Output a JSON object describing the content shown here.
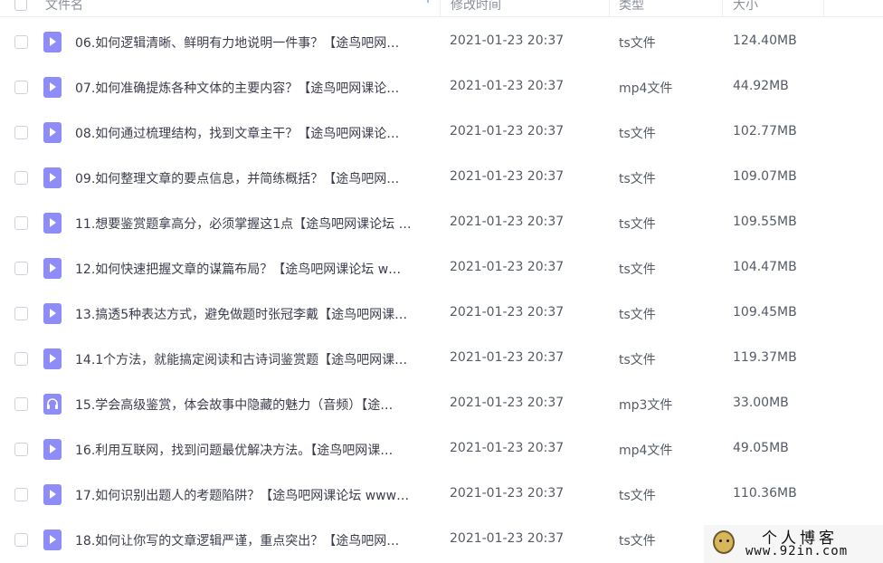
{
  "header": {
    "col_name": "文件名",
    "col_modified": "修改时间",
    "col_type": "类型",
    "col_size": "大小",
    "sort_icon": "sort-ascending-icon"
  },
  "files": [
    {
      "name": "06.如何逻辑清晰、鲜明有力地说明一件事？【途鸟吧网…",
      "date": "2021-01-23 20:37",
      "type": "ts文件",
      "size": "124.40MB",
      "icon": "video"
    },
    {
      "name": "07.如何准确提炼各种文体的主要内容？【途鸟吧网课论…",
      "date": "2021-01-23 20:37",
      "type": "mp4文件",
      "size": "44.92MB",
      "icon": "video"
    },
    {
      "name": "08.如何通过梳理结构，找到文章主干？【途鸟吧网课论…",
      "date": "2021-01-23 20:37",
      "type": "ts文件",
      "size": "102.77MB",
      "icon": "video"
    },
    {
      "name": "09.如何整理文章的要点信息，并简练概括？【途鸟吧网…",
      "date": "2021-01-23 20:37",
      "type": "ts文件",
      "size": "109.07MB",
      "icon": "video"
    },
    {
      "name": "11.想要鉴赏题拿高分，必须掌握这1点【途鸟吧网课论坛 …",
      "date": "2021-01-23 20:37",
      "type": "ts文件",
      "size": "109.55MB",
      "icon": "video"
    },
    {
      "name": "12.如何快速把握文章的谋篇布局？【途鸟吧网课论坛 w…",
      "date": "2021-01-23 20:37",
      "type": "ts文件",
      "size": "104.47MB",
      "icon": "video"
    },
    {
      "name": "13.搞透5种表达方式，避免做题时张冠李戴【途鸟吧网课…",
      "date": "2021-01-23 20:37",
      "type": "ts文件",
      "size": "109.45MB",
      "icon": "video"
    },
    {
      "name": "14.1个方法，就能搞定阅读和古诗词鉴赏题【途鸟吧网课…",
      "date": "2021-01-23 20:37",
      "type": "ts文件",
      "size": "119.37MB",
      "icon": "video"
    },
    {
      "name": "15.学会高级鉴赏，体会故事中隐藏的魅力（音频）【途…",
      "date": "2021-01-23 20:37",
      "type": "mp3文件",
      "size": "33.00MB",
      "icon": "audio"
    },
    {
      "name": "16.利用互联网，找到问题最优解决方法。【途鸟吧网课…",
      "date": "2021-01-23 20:37",
      "type": "mp4文件",
      "size": "49.05MB",
      "icon": "video"
    },
    {
      "name": "17.如何识别出题人的考题陷阱？【途鸟吧网课论坛 www…",
      "date": "2021-01-23 20:37",
      "type": "ts文件",
      "size": "110.36MB",
      "icon": "video"
    },
    {
      "name": "18.如何让你写的文章逻辑严谨，重点突出？【途鸟吧网…",
      "date": "2021-01-23 20:37",
      "type": "ts文件",
      "size": "",
      "icon": "video"
    }
  ],
  "watermark": {
    "title": "个人博客",
    "url": "www.92in.com"
  }
}
